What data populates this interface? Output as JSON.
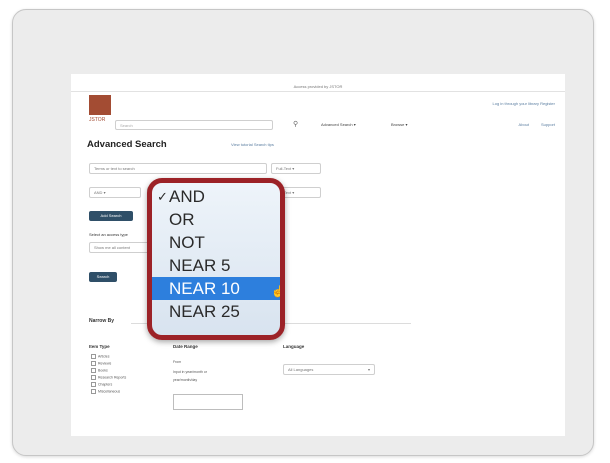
{
  "header": {
    "access_text": "Access provided by JSTOR",
    "logo_text": "JSTOR",
    "right_links": "Log in through your library   Register",
    "search_placeholder": "Search",
    "nav": [
      "Advanced Search",
      "Browse",
      "About",
      "Support"
    ]
  },
  "page": {
    "title": "Advanced Search",
    "title_links": "View tutorial   Search tips"
  },
  "form": {
    "query_placeholder": "Terms or text to search",
    "field_select": "Full-Text",
    "operator_select": "AND",
    "field_select_2": "Full-Text",
    "add_row_button": "Add Search",
    "narrow_label": "Select an access type",
    "narrow_select": "Show me all content",
    "search_button": "Search"
  },
  "narrow": {
    "section_title": "Narrow By",
    "item_type_header": "Item Type",
    "item_types": [
      "Articles",
      "Reviews",
      "Books",
      "Research Reports",
      "Chapters",
      "Miscellaneous"
    ],
    "date_header": "Date Range",
    "date_lines": [
      "From",
      "Input in year/month or",
      "year/month/day"
    ],
    "language_header": "Language",
    "language_select": "All Languages"
  },
  "operator_dropdown": {
    "options": [
      "AND",
      "OR",
      "NOT",
      "NEAR 5",
      "NEAR 10",
      "NEAR 25"
    ],
    "checked": "AND",
    "hovered": "NEAR 10",
    "highlight_color": "#2d7fdd",
    "border_color": "#9c2227"
  }
}
